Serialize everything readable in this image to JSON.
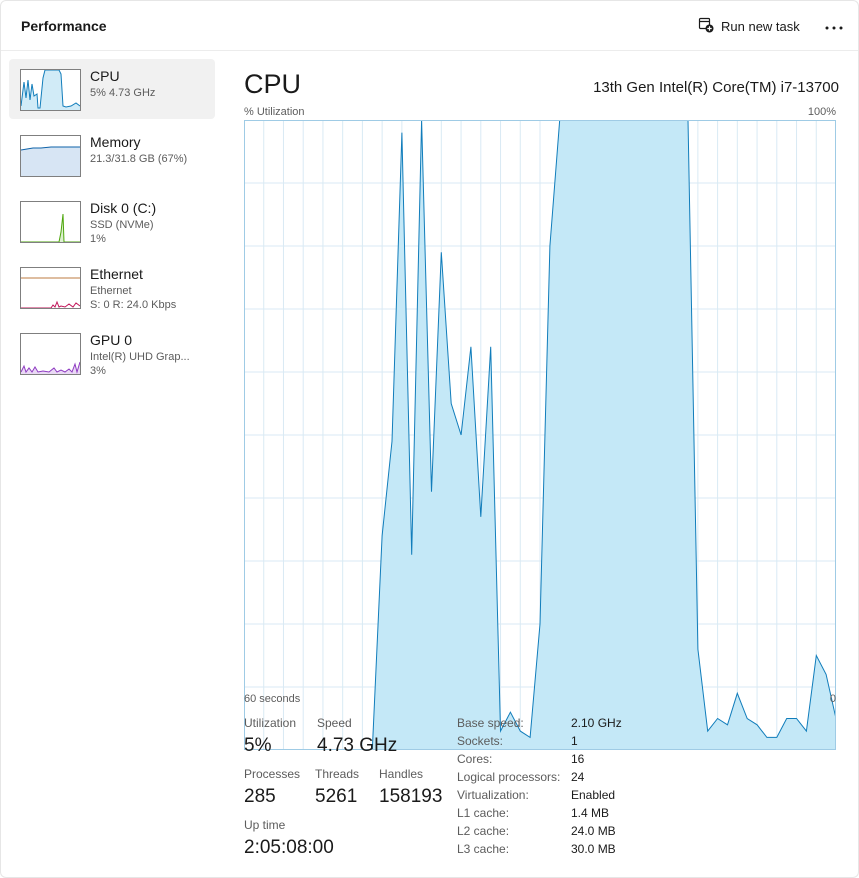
{
  "header": {
    "title": "Performance",
    "run_new_task": "Run new task",
    "more_icon": "more-horizontal-icon"
  },
  "sidebar": {
    "items": [
      {
        "name": "CPU",
        "sub1": "5% 4.73 GHz",
        "sub2": "",
        "color": "#117dbb",
        "active": true
      },
      {
        "name": "Memory",
        "sub1": "21.3/31.8 GB (67%)",
        "sub2": "",
        "color": "#0e62a8",
        "active": false
      },
      {
        "name": "Disk 0 (C:)",
        "sub1": "SSD (NVMe)",
        "sub2": "1%",
        "color": "#4da60c",
        "active": false
      },
      {
        "name": "Ethernet",
        "sub1": "Ethernet",
        "sub2": "S: 0 R: 24.0 Kbps",
        "color": "#a74f01",
        "active": false
      },
      {
        "name": "GPU 0",
        "sub1": "Intel(R) UHD Grap...",
        "sub2": "3%",
        "color": "#8e3ac1",
        "active": false
      }
    ]
  },
  "cpu": {
    "title": "CPU",
    "model": "13th Gen Intel(R) Core(TM) i7-13700",
    "util_label": "% Utilization",
    "util_max": "100%",
    "time_left": "60 seconds",
    "time_right": "0",
    "line_color": "#117dbb",
    "fill_color": "#c4e8f7",
    "grid_color": "#d9eaf4"
  },
  "chart_data": {
    "type": "area",
    "title": "",
    "xlabel": "",
    "ylabel": "% Utilization",
    "xlim": [
      60,
      0
    ],
    "ylim": [
      0,
      100
    ],
    "grid": true,
    "x": [
      60,
      59,
      58,
      57,
      56,
      55,
      54,
      53,
      52,
      51,
      50,
      49,
      48,
      47,
      46,
      45,
      44,
      43,
      42,
      41,
      40,
      39,
      38,
      37,
      36,
      35,
      34,
      33,
      32,
      31,
      30,
      29,
      28,
      27,
      26,
      25,
      24,
      23,
      22,
      21,
      20,
      19,
      18,
      17,
      16,
      15,
      14,
      13,
      12,
      11,
      10,
      9,
      8,
      7,
      6,
      5,
      4,
      3,
      2,
      1,
      0
    ],
    "values": [
      0,
      0,
      0,
      0,
      0,
      0,
      0,
      0,
      0,
      0,
      0,
      0,
      0,
      0,
      34,
      49,
      98,
      31,
      100,
      41,
      79,
      55,
      50,
      64,
      37,
      64,
      3,
      6,
      3,
      2,
      20,
      80,
      100,
      100,
      100,
      100,
      100,
      100,
      100,
      100,
      100,
      100,
      100,
      100,
      100,
      100,
      16,
      3,
      5,
      4,
      9,
      5,
      4,
      2,
      2,
      5,
      5,
      3,
      15,
      12,
      5
    ]
  },
  "stats": {
    "utilization_label": "Utilization",
    "utilization_value": "5%",
    "speed_label": "Speed",
    "speed_value": "4.73 GHz",
    "processes_label": "Processes",
    "processes_value": "285",
    "threads_label": "Threads",
    "threads_value": "5261",
    "handles_label": "Handles",
    "handles_value": "158193",
    "uptime_label": "Up time",
    "uptime_value": "2:05:08:00"
  },
  "specs": [
    {
      "label": "Base speed:",
      "value": "2.10 GHz"
    },
    {
      "label": "Sockets:",
      "value": "1"
    },
    {
      "label": "Cores:",
      "value": "16"
    },
    {
      "label": "Logical processors:",
      "value": "24"
    },
    {
      "label": "Virtualization:",
      "value": "Enabled"
    },
    {
      "label": "L1 cache:",
      "value": "1.4 MB"
    },
    {
      "label": "L2 cache:",
      "value": "24.0 MB"
    },
    {
      "label": "L3 cache:",
      "value": "30.0 MB"
    }
  ]
}
